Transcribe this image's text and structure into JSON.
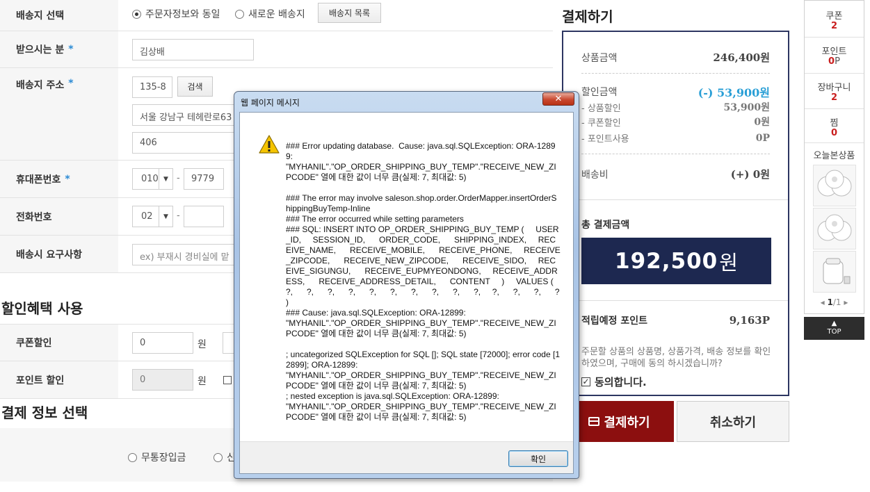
{
  "shipping": {
    "select_label": "배송지 선택",
    "radio_same": "주문자정보와 동일",
    "radio_new": "새로운 배송지",
    "list_button": "배송지 목록",
    "receiver_label": "받으시는 분",
    "receiver_value": "김상배",
    "address_label": "배송지 주소",
    "zipcode_value": "135-8",
    "search_button": "검색",
    "address1_value": "서울 강남구 테헤란로63",
    "address2_value": "406",
    "mobile_label": "휴대폰번호",
    "mobile_prefix": "010",
    "mobile_mid": "9779",
    "phone_label": "전화번호",
    "phone_prefix": "02",
    "request_label": "배송시 요구사항",
    "request_placeholder": "ex) 부재시 경비실에 맡",
    "required_mark": "*",
    "dash": "-"
  },
  "discount": {
    "section_title": "할인혜택 사용",
    "coupon_label": "쿠폰할인",
    "coupon_value": "0",
    "point_label": "포인트 할인",
    "point_value": "0",
    "won_unit": "원"
  },
  "payment": {
    "section_title": "결제 정보 선택",
    "method_bank": "무통장입금",
    "method_second": "신"
  },
  "summary": {
    "title": "결제하기",
    "product_amount_label": "상품금액",
    "product_amount": "246,400원",
    "discount_label": "할인금액",
    "discount_amount": "(-) 53,900원",
    "product_discount_label": "- 상품할인",
    "product_discount": "53,900원",
    "coupon_discount_label": "- 쿠폰할인",
    "coupon_discount": "0원",
    "point_use_label": "- 포인트사용",
    "point_use": "0P",
    "shipping_fee_label": "배송비",
    "shipping_fee": "(+) 0원",
    "total_label": "총 결제금액",
    "total_number": "192,500",
    "total_unit": "원",
    "points_label": "적립예정 포인트",
    "points_value": "9,163P",
    "agree_text": "주문할 상품의 상품명, 상품가격, 배송 정보를 확인하였으며, 구매에 동의 하시겠습니까?",
    "agree_label": "동의합니다.",
    "pay_button": "결제하기",
    "cancel_button": "취소하기",
    "accent_color": "#2a9fd6",
    "navy_color": "#1d2850",
    "pay_color": "#8c0f0f"
  },
  "quick_menu": {
    "coupon_label": "쿠폰",
    "coupon_count": "2",
    "point_label": "포인트",
    "point_count": "0",
    "point_unit": "P",
    "cart_label": "장바구니",
    "cart_count": "2",
    "wish_label": "찜",
    "wish_count": "0",
    "recent_label": "오늘본상품",
    "page_current": "1",
    "page_total": "/1",
    "top_label": "TOP"
  },
  "dialog": {
    "title": "웹 페이지 메시지",
    "close_symbol": "✕",
    "message": "### Error updating database.  Cause: java.sql.SQLException: ORA-12899:\n\"MYHANIL\".\"OP_ORDER_SHIPPING_BUY_TEMP\".\"RECEIVE_NEW_ZIPCODE\" 열에 대한 값이 너무 큼(실제: 7, 최대값: 5)\n\n### The error may involve saleson.shop.order.OrderMapper.insertOrderShippingBuyTemp-Inline\n### The error occurred while setting parameters\n### SQL: INSERT INTO OP_ORDER_SHIPPING_BUY_TEMP (     USER_ID,     SESSION_ID,      ORDER_CODE,      SHIPPING_INDEX,     RECEIVE_NAME,      RECEIVE_MOBILE,      RECEIVE_PHONE,     RECEIVE_ZIPCODE,      RECEIVE_NEW_ZIPCODE,      RECEIVE_SIDO,     RECEIVE_SIGUNGU,      RECEIVE_EUPMYEONDONG,     RECEIVE_ADDRESS,      RECEIVE_ADDRESS_DETAIL,      CONTENT     )     VALUES (     ?,      ?,      ?,      ?,      ?,      ?,      ?,      ?,      ?,      ?,     ?,      ?,      ?,      ?  )\n### Cause: java.sql.SQLException: ORA-12899:\n\"MYHANIL\".\"OP_ORDER_SHIPPING_BUY_TEMP\".\"RECEIVE_NEW_ZIPCODE\" 열에 대한 값이 너무 큼(실제: 7, 최대값: 5)\n\n; uncategorized SQLException for SQL []; SQL state [72000]; error code [12899]; ORA-12899:\n\"MYHANIL\".\"OP_ORDER_SHIPPING_BUY_TEMP\".\"RECEIVE_NEW_ZIPCODE\" 열에 대한 값이 너무 큼(실제: 7, 최대값: 5)\n; nested exception is java.sql.SQLException: ORA-12899:\n\"MYHANIL\".\"OP_ORDER_SHIPPING_BUY_TEMP\".\"RECEIVE_NEW_ZIPCODE\" 열에 대한 값이 너무 큼(실제: 7, 최대값: 5)",
    "ok_button": "확인"
  }
}
